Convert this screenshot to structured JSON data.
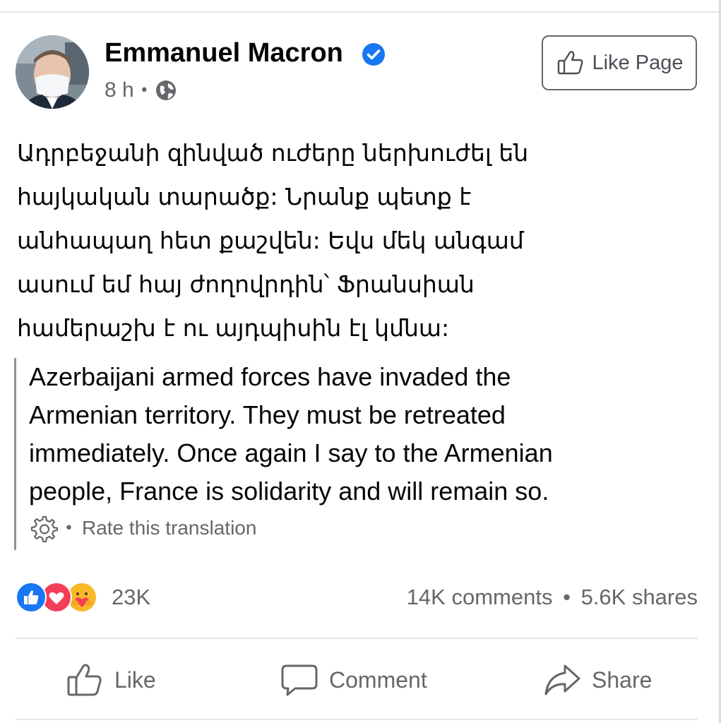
{
  "post": {
    "author_name": "Emmanuel Macron",
    "timestamp": "8 h",
    "meta_separator": "•",
    "audience_icon": "globe-icon",
    "verified_icon": "verified-badge-icon",
    "like_page_label": "Like Page",
    "text_armenian_lines": [
      "Ադրբեջանի զինված ուժերը ներխուժել են",
      "հայկական տարածք: Նրանք պետք է",
      "անհապաղ հետ քաշվեն: Եվս մեկ անգամ",
      "ասում եմ հայ ժողովրդին՝ Ֆրանսիան",
      "համերաշխ է ու այդպիսին էլ կմնա:"
    ],
    "translation_lines": [
      "Azerbaijani armed forces have invaded the",
      "Armenian territory. They must be retreated",
      "immediately. Once again I say to the Armenian",
      "people, France is solidarity and will remain so."
    ],
    "rate_dot": "•",
    "rate_translation_label": "Rate this translation"
  },
  "engagement": {
    "reaction_icons": [
      "like-reaction-icon",
      "love-reaction-icon",
      "care-reaction-icon"
    ],
    "reactions_count": "23K",
    "comments": "14K comments",
    "separator": "•",
    "shares": "5.6K shares"
  },
  "actions": {
    "like_label": "Like",
    "comment_label": "Comment",
    "share_label": "Share"
  },
  "colors": {
    "facebook_blue": "#1877f2",
    "love_red": "#f33e58",
    "care_yellow": "#f7b928",
    "secondary_text": "#65676b",
    "divider": "#e4e6eb"
  }
}
